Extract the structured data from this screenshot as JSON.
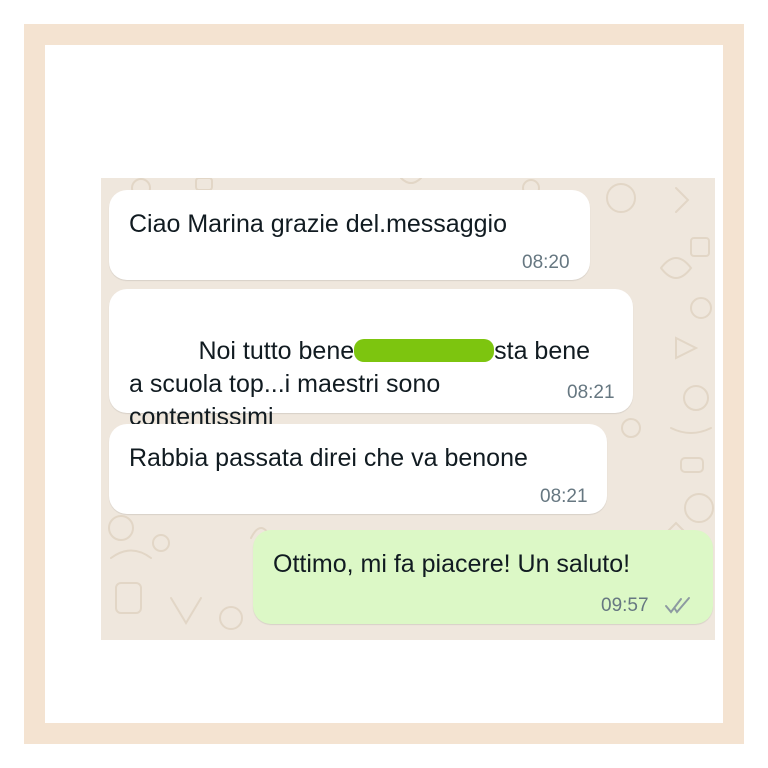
{
  "chat": {
    "messages": [
      {
        "direction": "incoming",
        "text": "Ciao Marina grazie del.messaggio",
        "time": "08:20"
      },
      {
        "direction": "incoming",
        "text_before": "Noi tutto bene",
        "redacted": true,
        "text_after": "sta bene",
        "line2": "a scuola top...i maestri sono",
        "line3": "contentissimi",
        "time": "08:21"
      },
      {
        "direction": "incoming",
        "text": "Rabbia passata direi che va benone",
        "time": "08:21"
      },
      {
        "direction": "outgoing",
        "text": "Ottimo, mi fa piacere! Un saluto!",
        "time": "09:57",
        "status_icon": "double-check-icon"
      }
    ]
  },
  "colors": {
    "frame": "#f4e3d1",
    "chat_background": "#efe7dd",
    "incoming_bubble": "#ffffff",
    "outgoing_bubble": "#dcf8c6",
    "timestamp": "#667781",
    "redaction": "#7dc50f"
  }
}
